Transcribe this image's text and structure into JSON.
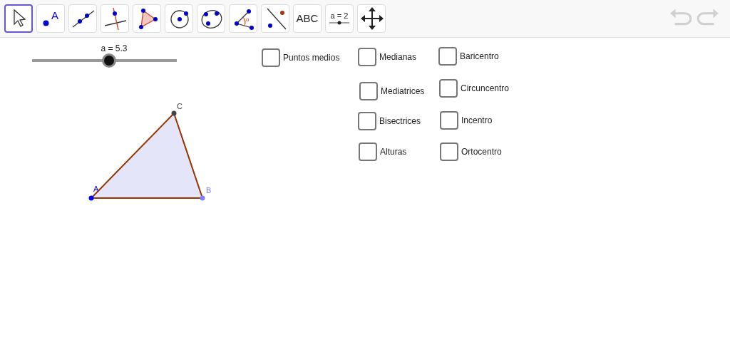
{
  "toolbar": {
    "tools": [
      {
        "kind": "move",
        "selected": true
      },
      {
        "kind": "point",
        "selected": false,
        "label": "A"
      },
      {
        "kind": "line",
        "selected": false
      },
      {
        "kind": "perpendicular",
        "selected": false
      },
      {
        "kind": "polygon",
        "selected": false
      },
      {
        "kind": "circle",
        "selected": false
      },
      {
        "kind": "conic",
        "selected": false
      },
      {
        "kind": "angle",
        "selected": false,
        "label": "α"
      },
      {
        "kind": "reflect",
        "selected": false
      },
      {
        "kind": "text",
        "selected": false,
        "label": "ABC"
      },
      {
        "kind": "slider",
        "selected": false,
        "label": "a = 2"
      },
      {
        "kind": "move-view",
        "selected": false
      }
    ],
    "undo": {
      "disabled": true
    },
    "redo": {
      "disabled": true
    }
  },
  "slider": {
    "label": "a = 5.3",
    "level": 0.53
  },
  "triangle": {
    "points": [
      {
        "label": "A",
        "color": "#0000ff"
      },
      {
        "label": "B",
        "color": "#7f7fff"
      },
      {
        "label": "C",
        "color": "#444444"
      }
    ]
  },
  "checkboxes": [
    {
      "label": "Puntos medios",
      "checked": false
    },
    {
      "label": "Medianas",
      "checked": false
    },
    {
      "label": "Baricentro",
      "checked": false
    },
    {
      "label": "Mediatrices",
      "checked": false
    },
    {
      "label": "Circuncentro",
      "checked": false
    },
    {
      "label": "Bisectrices",
      "checked": false
    },
    {
      "label": "Incentro",
      "checked": false
    },
    {
      "label": "Alturas",
      "checked": false
    },
    {
      "label": "Ortocentro",
      "checked": false
    }
  ]
}
